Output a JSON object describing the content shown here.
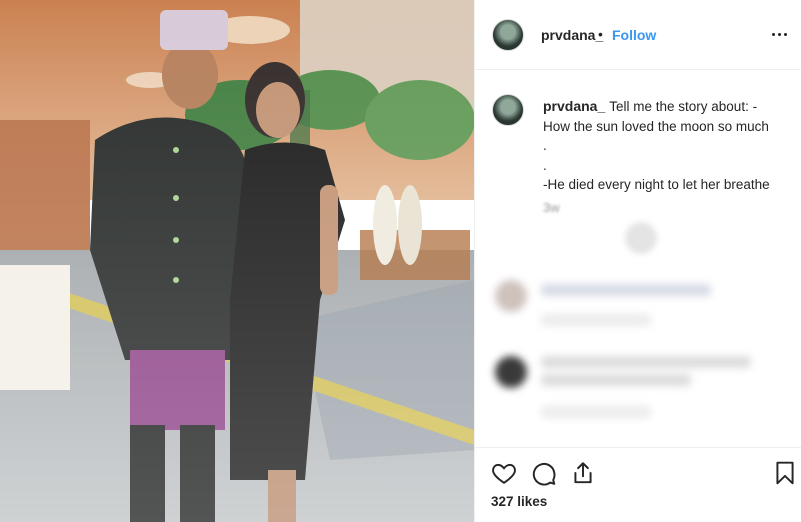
{
  "post": {
    "username": "prvdana_",
    "separator": "•",
    "follow_label": "Follow",
    "more_icon": "more-options-icon",
    "caption": {
      "lines": [
        "Tell me the story about: -",
        "How the sun loved the moon so much",
        ".",
        ".",
        "-He died every night to let her breathe"
      ]
    },
    "timestamp": "3w",
    "likes": "327 likes"
  },
  "actions": {
    "icons": [
      "heart-icon",
      "comment-icon",
      "share-icon",
      "bookmark-icon"
    ]
  },
  "colors": {
    "link_blue": "#3897f0",
    "text": "#262626",
    "muted": "#999999",
    "border": "#efefef"
  }
}
